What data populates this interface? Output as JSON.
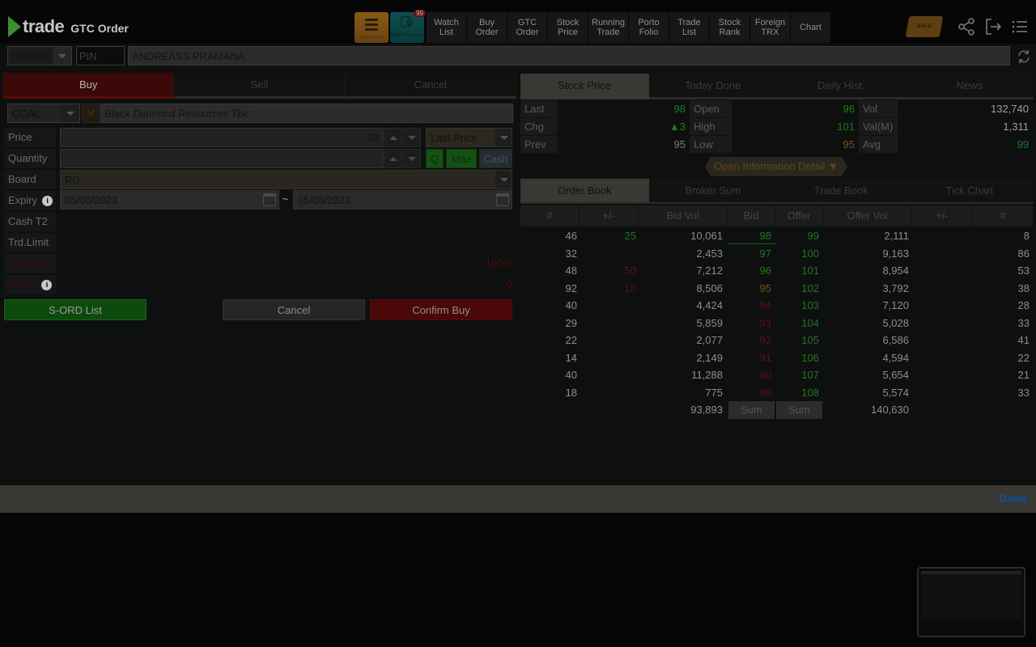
{
  "app": {
    "logo_text": "trade",
    "page_title": "GTC Order"
  },
  "nav": {
    "stock_feed_caption": "Stock Feed",
    "mnc_caption": "MNC Research",
    "mnc_badge": "99",
    "items": [
      {
        "l1": "Watch",
        "l2": "List"
      },
      {
        "l1": "Buy",
        "l2": "Order"
      },
      {
        "l1": "GTC",
        "l2": "Order"
      },
      {
        "l1": "Stock",
        "l2": "Price"
      },
      {
        "l1": "Running",
        "l2": "Trade"
      },
      {
        "l1": "Porto",
        "l2": "Folio"
      },
      {
        "l1": "Trade",
        "l2": "List"
      },
      {
        "l1": "Stock",
        "l2": "Rank"
      },
      {
        "l1": "Foreign",
        "l2": "TRX"
      },
      {
        "l1": "Chart",
        "l2": ""
      }
    ],
    "promo_text": "SALE"
  },
  "account": {
    "number": "0005303",
    "pin_placeholder": "PIN",
    "name": "ANDREASS PRAMANA"
  },
  "order": {
    "tabs": [
      "Buy",
      "Sell",
      "Cancel"
    ],
    "active_tab": "Buy",
    "stock_code": "COAL",
    "stock_flag": "M",
    "stock_name": "Black Diamond Resources Tbk.",
    "labels": {
      "price": "Price",
      "quantity": "Quantity",
      "board": "Board",
      "expiry": "Expiry",
      "cash_t2": "Cash T2",
      "trd_limit": "Trd.Limit",
      "net_ac": "Net Cut",
      "total": "Total"
    },
    "price_value": "98",
    "price_type": "Last Price",
    "quantity_value": "",
    "q_btn": "Q",
    "max_btn": "Max",
    "cash_btn": "Cash",
    "board_value": "RG",
    "expiry_from": "05/06/2023",
    "expiry_sep": "~",
    "expiry_to": "05/06/2023",
    "net_value": "100%",
    "total_value": "0",
    "sord_button": "S-ORD List",
    "cancel_button": "Cancel",
    "confirm_button": "Confirm Buy"
  },
  "quote": {
    "tabs": [
      "Stock Price",
      "Today Done",
      "Daily Hist.",
      "News"
    ],
    "active_tab": "Stock Price",
    "rows": [
      [
        {
          "label": "Last",
          "value": "98",
          "color": "green"
        },
        {
          "label": "Open",
          "value": "96",
          "color": "green"
        },
        {
          "label": "Vol",
          "value": "132,740",
          "color": "white"
        }
      ],
      [
        {
          "label": "Chg",
          "value": "▲3",
          "color": "green"
        },
        {
          "label": "High",
          "value": "101",
          "color": "green"
        },
        {
          "label": "Val(M)",
          "value": "1,311",
          "color": "white"
        }
      ],
      [
        {
          "label": "Prev",
          "value": "95",
          "color": "grey"
        },
        {
          "label": "Low",
          "value": "95",
          "color": "gold"
        },
        {
          "label": "Avg",
          "value": "99",
          "color": "green"
        }
      ]
    ],
    "info_toggle": "Open Information Detail ▼"
  },
  "orderbook": {
    "tabs": [
      "Order Book",
      "Broker Sum",
      "Trade Book",
      "Tick Chart"
    ],
    "active_tab": "Order Book",
    "headers": [
      "#",
      "+/-",
      "Bid Vol",
      "Bid",
      "Offer",
      "Offer Vol",
      "+/-",
      "#"
    ],
    "rows": [
      {
        "bn": "46",
        "bchg": "25",
        "bchgc": "green",
        "bvol": "10,061",
        "bid": "98",
        "bidc": "green",
        "off": "99",
        "offc": "green",
        "ovol": "2,111",
        "ochg": "",
        "on": "8"
      },
      {
        "bn": "32",
        "bchg": "",
        "bchgc": "",
        "bvol": "2,453",
        "bid": "97",
        "bidc": "green",
        "off": "100",
        "offc": "green",
        "ovol": "9,163",
        "ochg": "",
        "on": "86"
      },
      {
        "bn": "48",
        "bchg": "50",
        "bchgc": "red",
        "bvol": "7,212",
        "bid": "96",
        "bidc": "green",
        "off": "101",
        "offc": "green",
        "ovol": "8,954",
        "ochg": "",
        "on": "53"
      },
      {
        "bn": "92",
        "bchg": "10",
        "bchgc": "red",
        "bvol": "8,506",
        "bid": "95",
        "bidc": "gold",
        "off": "102",
        "offc": "green",
        "ovol": "3,792",
        "ochg": "",
        "on": "38"
      },
      {
        "bn": "40",
        "bchg": "",
        "bchgc": "",
        "bvol": "4,424",
        "bid": "94",
        "bidc": "red",
        "off": "103",
        "offc": "green",
        "ovol": "7,120",
        "ochg": "",
        "on": "28"
      },
      {
        "bn": "29",
        "bchg": "",
        "bchgc": "",
        "bvol": "5,859",
        "bid": "93",
        "bidc": "red",
        "off": "104",
        "offc": "green",
        "ovol": "5,028",
        "ochg": "",
        "on": "33"
      },
      {
        "bn": "22",
        "bchg": "",
        "bchgc": "",
        "bvol": "2,077",
        "bid": "92",
        "bidc": "red",
        "off": "105",
        "offc": "green",
        "ovol": "6,586",
        "ochg": "",
        "on": "41"
      },
      {
        "bn": "14",
        "bchg": "",
        "bchgc": "",
        "bvol": "2,149",
        "bid": "91",
        "bidc": "red",
        "off": "106",
        "offc": "green",
        "ovol": "4,594",
        "ochg": "",
        "on": "22"
      },
      {
        "bn": "40",
        "bchg": "",
        "bchgc": "",
        "bvol": "11,288",
        "bid": "90",
        "bidc": "red",
        "off": "107",
        "offc": "green",
        "ovol": "5,654",
        "ochg": "",
        "on": "21"
      },
      {
        "bn": "18",
        "bchg": "",
        "bchgc": "",
        "bvol": "775",
        "bid": "89",
        "bidc": "red",
        "off": "108",
        "offc": "green",
        "ovol": "5,574",
        "ochg": "",
        "on": "33"
      }
    ],
    "total_bid_vol": "93,893",
    "sum_label_bid": "Sum",
    "sum_label_offer": "Sum",
    "total_offer_vol": "140,630"
  },
  "done_bar": {
    "done_label": "Done"
  },
  "colors": {
    "buy_tab": "#3c0808",
    "green_text": "#1e7a1e",
    "red_text": "#5e1111",
    "gold_text": "#6e5615",
    "done_link": "#0a4fa0"
  }
}
